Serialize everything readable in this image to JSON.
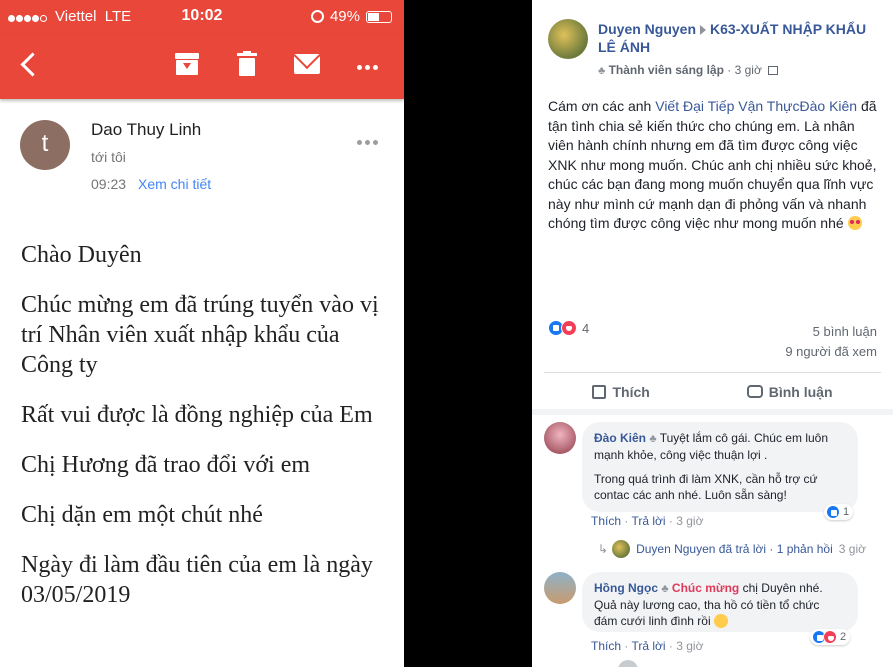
{
  "gmail": {
    "status": {
      "carrier": "Viettel",
      "network": "LTE",
      "time": "10:02",
      "battery": "49%"
    },
    "toolbar": {
      "icons": [
        "back-icon",
        "archive-icon",
        "trash-icon",
        "mail-icon",
        "more-icon"
      ],
      "accent": "#e8473a"
    },
    "sender": {
      "initial": "t",
      "name": "Dao Thuy Linh",
      "to": "tới tôi",
      "time": "09:23",
      "details_link": "Xem chi tiết"
    },
    "body": [
      "Chào Duyên",
      "Chúc mừng em đã trúng tuyển vào vị trí Nhân viên xuất nhập khẩu của Công ty",
      "Rất vui được là đồng nghiệp của Em",
      "Chị Hương đã trao đổi với em",
      "Chị dặn em một chút nhé",
      "Ngày đi làm đầu tiên của em là ngày 03/05/2019"
    ]
  },
  "facebook": {
    "post": {
      "author": "Duyen Nguyen",
      "group": "K63-XUẤT NHẬP KHẨU LÊ ÁNH",
      "badge": "Thành viên sáng lập",
      "time": "3 giờ",
      "text_prefix": "Cám ơn các anh ",
      "mentions": "Viết Đại Tiếp Vận ThựcĐào Kiên",
      "text_rest": "đã tận tình chia sẻ kiến thức cho chúng em. Là nhân viên hành chính nhưng em đã tìm được công việc XNK như mong muốn. Chúc anh chị nhiều sức khoẻ, chúc các bạn đang mong muốn chuyển qua lĩnh vực này như mình cứ mạnh dạn đi phỏng vấn và nhanh chóng tìm được công việc như mong muốn nhé",
      "reaction_count": "4",
      "comments_count": "5 bình luận",
      "seen_count": "9 người đã xem"
    },
    "actions": {
      "like": "Thích",
      "comment": "Bình luận"
    },
    "comments": [
      {
        "name": "Đào Kiên",
        "line1": "Tuyệt lắm cô gái. Chúc em luôn mạnh khỏe, công việc thuận lợi .",
        "line2": "Trong quá trình đi làm XNK, cần hỗ trợ cứ contac các anh nhé. Luôn sẵn sàng!",
        "like": "Thích",
        "reply": "Trả lời",
        "time": "3 giờ",
        "reactions": "1"
      },
      {
        "name": "Hồng Ngọc",
        "mention": "Chúc mừng",
        "text": " chị Duyên nhé. Quả này lương cao, tha hồ có tiền tổ chức đám cưới linh đình rồi",
        "like": "Thích",
        "reply": "Trả lời",
        "time": "3 giờ",
        "reactions": "2"
      }
    ],
    "reply_summary": {
      "name": "Duyen Nguyen",
      "text": "đã trả lời",
      "count": "1 phản hồi",
      "time": "3 giờ"
    },
    "link_color": "#385898"
  }
}
